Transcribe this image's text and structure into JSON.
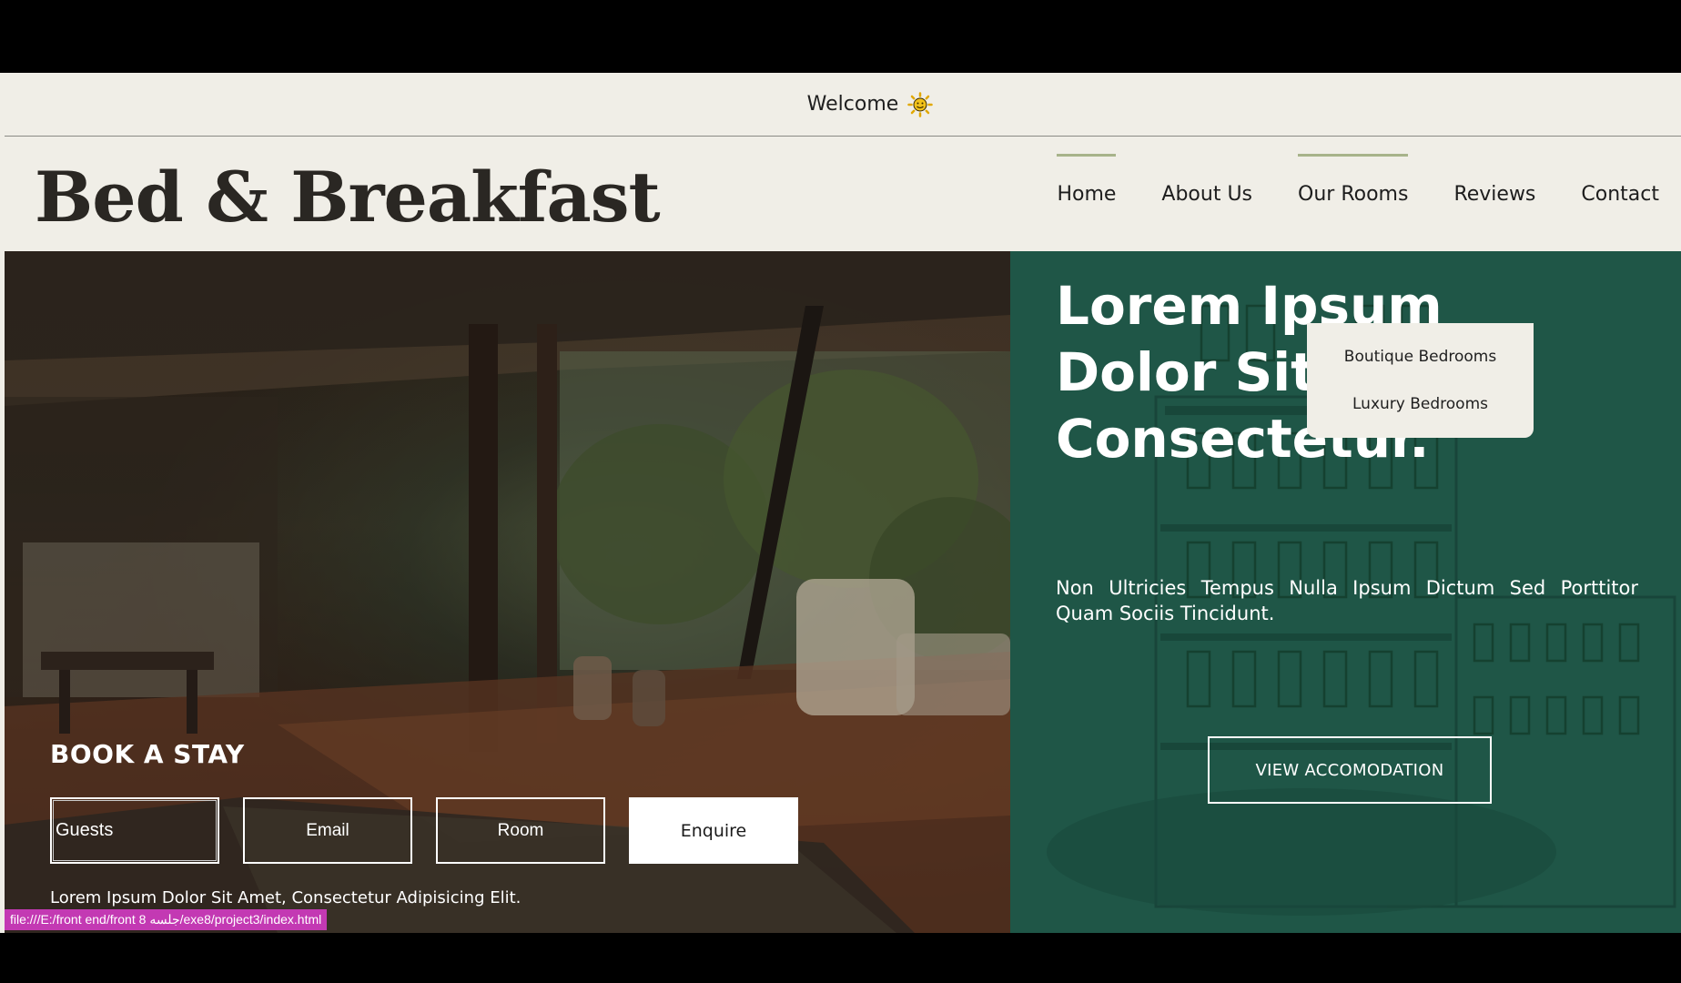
{
  "welcome_bar": {
    "text": "Welcome",
    "icon": "sun-icon"
  },
  "header": {
    "logo": "Bed & Breakfast",
    "nav": [
      {
        "label": "Home",
        "active": true
      },
      {
        "label": "About Us",
        "active": false
      },
      {
        "label": "Our Rooms",
        "active": true
      },
      {
        "label": "Reviews",
        "active": false
      },
      {
        "label": "Contact",
        "active": false
      }
    ],
    "dropdown": [
      "Boutique Bedrooms",
      "Luxury Bedrooms"
    ]
  },
  "booking": {
    "title": "BOOK A STAY",
    "fields": {
      "guests": "Guests",
      "email": "Email",
      "room": "Room"
    },
    "enquire_label": "Enquire",
    "note": "Lorem Ipsum Dolor Sit Amet, Consectetur Adipisicing Elit."
  },
  "hero": {
    "heading": "Lorem Ipsum Dolor Sit, Amet Consectetur.",
    "subtext": "Non Ultricies Tempus Nulla Ipsum Dictum Sed Porttitor Quam Sociis Tincidunt.",
    "button_label": "VIEW ACCOMODATION"
  },
  "status_bar": {
    "url": "file:///E:/front end/front 8 جلسه/exe8/project3/index.html"
  },
  "colors": {
    "page_bg": "#f0eee7",
    "hero_green": "#1f5647",
    "nav_accent": "#a7b38a",
    "status_pink": "#c339b3"
  }
}
